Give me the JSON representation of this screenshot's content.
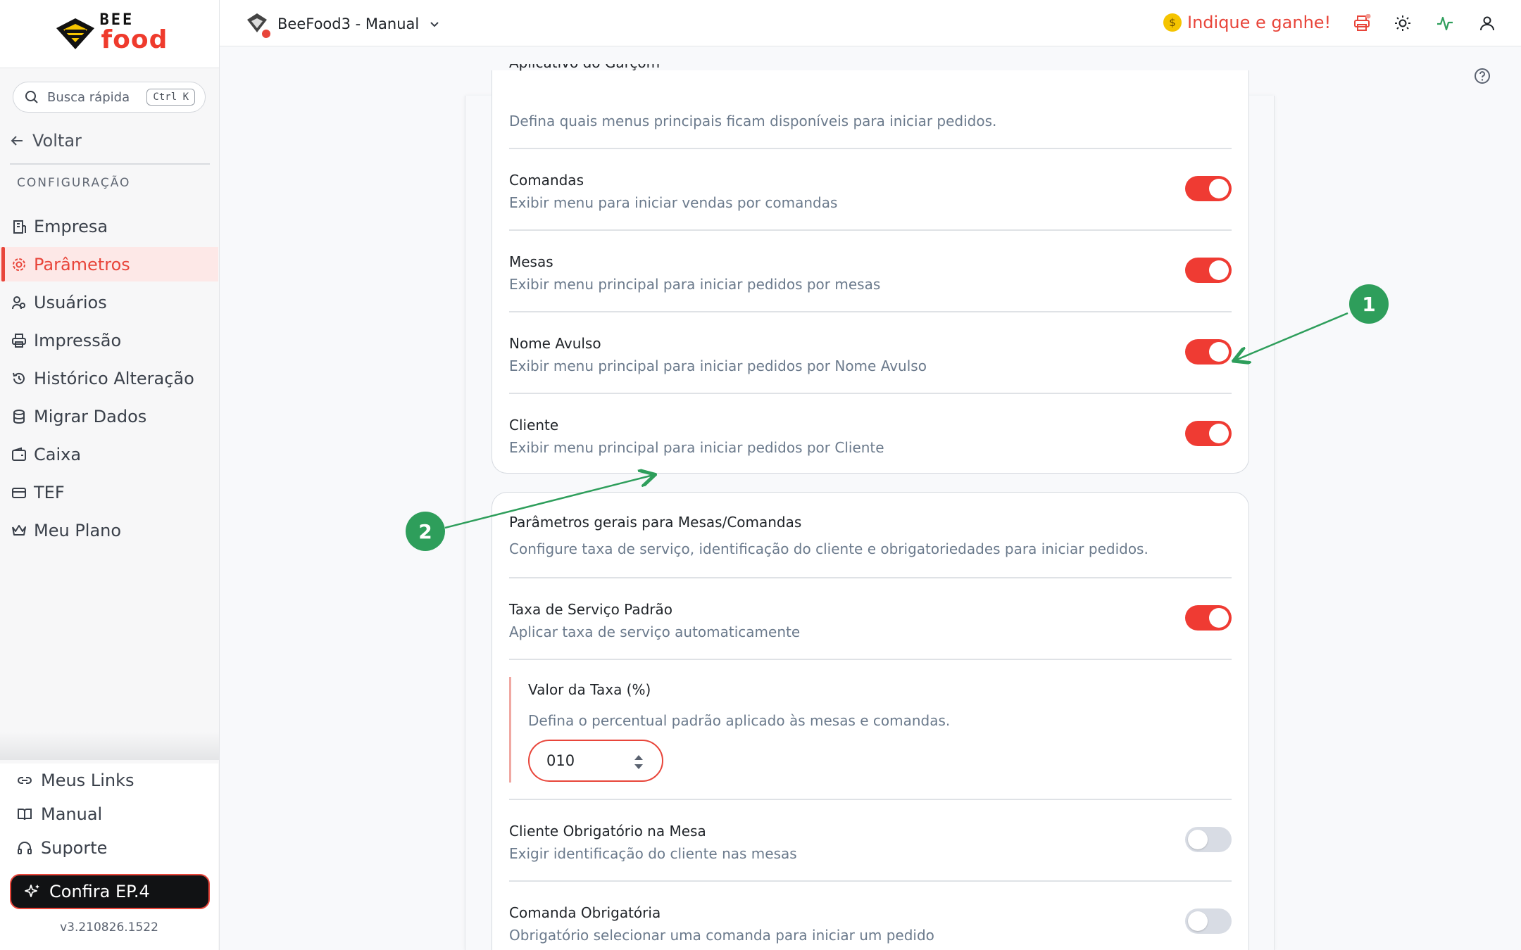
{
  "brand": {
    "logo_top": "BEE",
    "logo_bottom": "food"
  },
  "sidebar": {
    "search_placeholder": "Busca rápida",
    "search_shortcut": "Ctrl K",
    "back_label": "Voltar",
    "section_title": "CONFIGURAÇÃO",
    "items": [
      {
        "label": "Empresa",
        "icon": "building-icon"
      },
      {
        "label": "Parâmetros",
        "icon": "gear-icon",
        "active": true
      },
      {
        "label": "Usuários",
        "icon": "users-icon"
      },
      {
        "label": "Impressão",
        "icon": "printer-icon"
      },
      {
        "label": "Histórico Alteração",
        "icon": "history-icon"
      },
      {
        "label": "Migrar Dados",
        "icon": "database-icon"
      },
      {
        "label": "Caixa",
        "icon": "wallet-icon"
      },
      {
        "label": "TEF",
        "icon": "card-icon"
      },
      {
        "label": "Meu Plano",
        "icon": "crown-icon"
      }
    ],
    "bottom_links": [
      {
        "label": "Meus Links",
        "icon": "link-icon"
      },
      {
        "label": "Manual",
        "icon": "book-icon"
      },
      {
        "label": "Suporte",
        "icon": "headset-icon"
      }
    ],
    "cta_label": "Confira EP.4",
    "version": "v3.210826.1522"
  },
  "topbar": {
    "app_name": "BeeFood3 - Manual",
    "referral_label": "Indique e ganhe!"
  },
  "card1": {
    "header_title_partial": "Aplicativo do Garçom",
    "header_desc": "Defina quais menus principais ficam disponíveis para iniciar pedidos.",
    "rows": [
      {
        "title": "Comandas",
        "desc": "Exibir menu para iniciar vendas por comandas",
        "enabled": true
      },
      {
        "title": "Mesas",
        "desc": "Exibir menu principal para iniciar pedidos por mesas",
        "enabled": true
      },
      {
        "title": "Nome Avulso",
        "desc": "Exibir menu principal para iniciar pedidos por Nome Avulso",
        "enabled": true
      },
      {
        "title": "Cliente",
        "desc": "Exibir menu principal para iniciar pedidos por Cliente",
        "enabled": true
      }
    ]
  },
  "card2": {
    "header_title": "Parâmetros gerais para Mesas/Comandas",
    "header_desc": "Configure taxa de serviço, identificação do cliente e obrigatoriedades para iniciar pedidos.",
    "service_fee": {
      "title": "Taxa de Serviço Padrão",
      "desc": "Aplicar taxa de serviço automaticamente",
      "enabled": true
    },
    "fee_value": {
      "title": "Valor da Taxa (%)",
      "desc": "Defina o percentual padrão aplicado às mesas e comandas.",
      "value": "010"
    },
    "client_required": {
      "title": "Cliente Obrigatório na Mesa",
      "desc": "Exigir identificação do cliente nas mesas",
      "enabled": false
    },
    "comanda_required": {
      "title": "Comanda Obrigatória",
      "desc": "Obrigatório selecionar uma comanda para iniciar um pedido",
      "enabled": false
    }
  },
  "annotations": {
    "badge1": "1",
    "badge2": "2",
    "color": "#2e9e5b"
  },
  "colors": {
    "accent": "#ef3b33",
    "active_bg": "#fde8e7",
    "muted_text": "#6b7a8c"
  }
}
